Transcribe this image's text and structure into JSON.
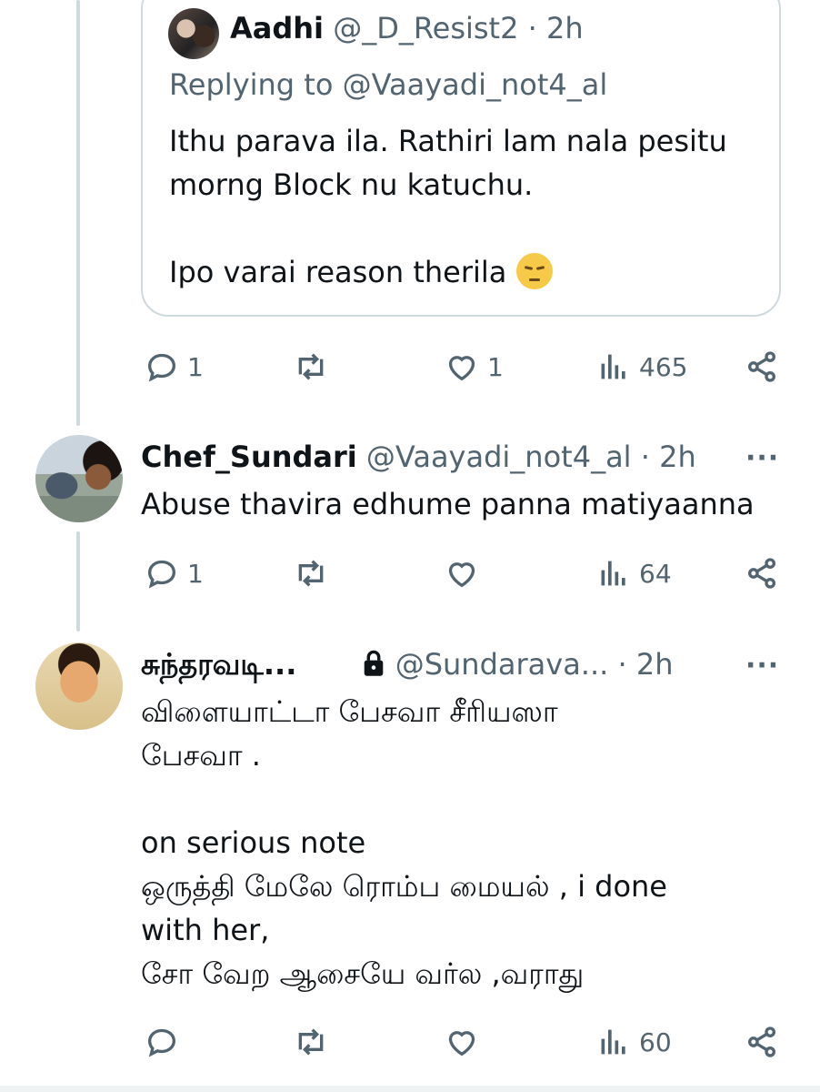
{
  "quoted_tweet": {
    "display_name": "Aadhi",
    "handle": "@_D_Resist2",
    "time": "· 2h",
    "replying_to": "Replying to @Vaayadi_not4_al",
    "body_line1": "Ithu parava ila. Rathiri lam nala pesitu",
    "body_line2": "morng Block nu katuchu.",
    "body_line3": "Ipo varai reason therila",
    "emoji": "pensive-face-emoji",
    "stats": {
      "replies": "1",
      "retweets": "",
      "likes": "1",
      "views": "465"
    }
  },
  "tweets": [
    {
      "display_name": "Chef_Sundari",
      "handle": "@Vaayadi_not4_al",
      "time": "· 2h",
      "more": "···",
      "body": "Abuse thavira edhume panna matiyaanna",
      "stats": {
        "replies": "1",
        "retweets": "",
        "likes": "",
        "views": "64"
      }
    },
    {
      "display_name": "சுந்தரவடி...",
      "handle": "@Sundarava...",
      "time": "· 2h",
      "more": "···",
      "protected_icon": "lock-icon",
      "body_lines": [
        "விளையாட்டா பேசவா சீரியஸா",
        "பேசவா .",
        "",
        "on serious note",
        "ஒருத்தி மேலே ரொம்ப மையல் , i done",
        "with her,",
        "சோ வேற ஆசையே வர்ல ,வராது"
      ],
      "stats": {
        "replies": "",
        "retweets": "",
        "likes": "",
        "views": "60"
      }
    }
  ],
  "colors": {
    "text": "#0f1419",
    "muted": "#536471",
    "border": "#cfd9de",
    "thread": "#cfd9de"
  }
}
